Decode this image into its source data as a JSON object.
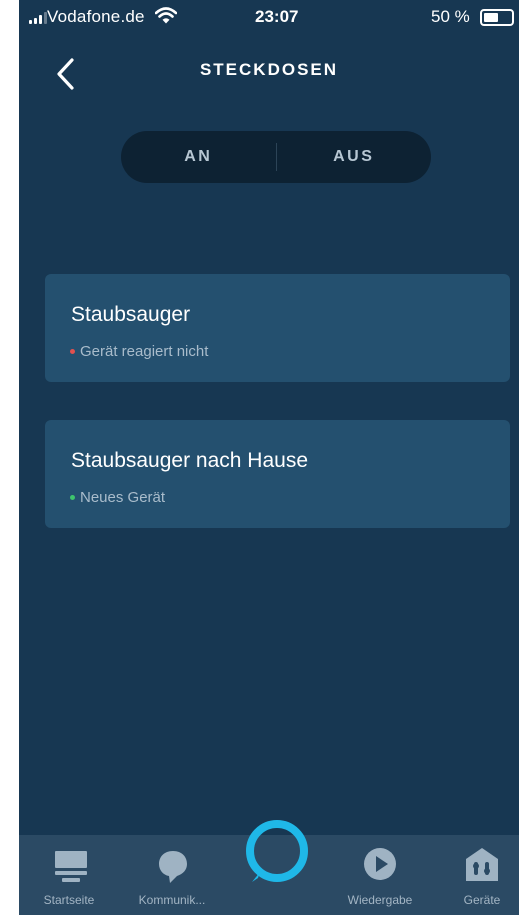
{
  "status_bar": {
    "carrier": "Vodafone.de",
    "time": "23:07",
    "battery": "50 %"
  },
  "header": {
    "title": "STECKDOSEN"
  },
  "toggle": {
    "on_label": "AN",
    "off_label": "AUS"
  },
  "devices": [
    {
      "name": "Staubsauger",
      "status": "Gerät reagiert nicht",
      "status_color": "#e2514f"
    },
    {
      "name": "Staubsauger nach Hause",
      "status": "Neues Gerät",
      "status_color": "#3ec46d"
    }
  ],
  "nav": {
    "items": [
      {
        "label": "Startseite",
        "icon": "home-icon"
      },
      {
        "label": "Kommunik...",
        "icon": "chat-bubble-icon"
      },
      {
        "label": "",
        "icon": "alexa-ring-icon"
      },
      {
        "label": "Wiedergabe",
        "icon": "play-icon"
      },
      {
        "label": "Geräte",
        "icon": "devices-house-icon"
      }
    ]
  },
  "colors": {
    "background": "#173752",
    "card": "#24506f",
    "nav_background": "#2b4a64",
    "alexa_accent": "#1fb8e8"
  }
}
